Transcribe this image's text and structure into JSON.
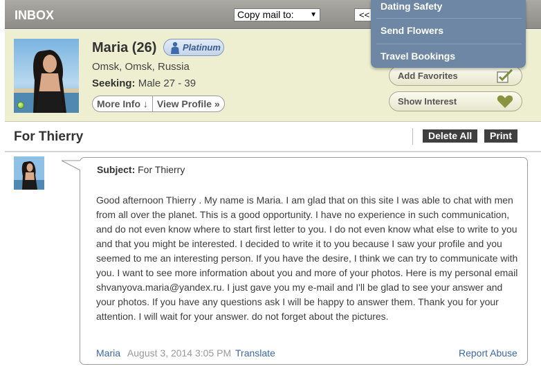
{
  "header": {
    "title": "INBOX",
    "copy_select": "Copy mail to:",
    "nav_button": "<< b"
  },
  "dropdown": {
    "items": [
      "Dating Safety",
      "Send Flowers",
      "Travel Bookings"
    ]
  },
  "profile": {
    "name": "Maria (26)",
    "badge": "Platinum",
    "location": "Omsk, Omsk, Russia",
    "seeking_label": "Seeking:",
    "seeking_value": "Male 27 - 39",
    "more_info": "More Info ↓",
    "view_profile": "View Profile »",
    "add_favorites": "Add Favorites",
    "show_interest": "Show Interest"
  },
  "message_header": {
    "title": "For Thierry",
    "delete_all": "Delete All",
    "print": "Print"
  },
  "message": {
    "subject_label": "Subject:",
    "subject_value": "For Thierry",
    "body": "Good afternoon Thierry . My name is Maria. I am glad that on this site I was able to chat with men from all over the planet. This is a good opportunity. I have no experience in such communication, and do not even know where to start first letter to you. I do not even know what else to write to you and that you might be interested. I decided to write it to you because I saw your profile and you seemed to me an interesting person. If you have the desire, I think we can try to communicate with you. I want to see more information about you and more of your photos. Here is my personal email shvanyova.maria@yandex.ru. I just gave you my e-mail and I'll be glad to see your answer and your photos. If you have any questions ask I will be happy to answer them. Thank you for your attention. I will wait for your answer. do not forget about the pictures.",
    "sender": "Maria",
    "date": "August 3, 2014 3:05 PM",
    "translate": "Translate",
    "report_abuse": "Report Abuse"
  },
  "colors": {
    "header_bar": "#9b9a95",
    "profile_bg": "#eeeed0",
    "dropdown_bg": "#6d87a4",
    "link": "#3b67a7",
    "dark_button": "#3f3f3f"
  }
}
